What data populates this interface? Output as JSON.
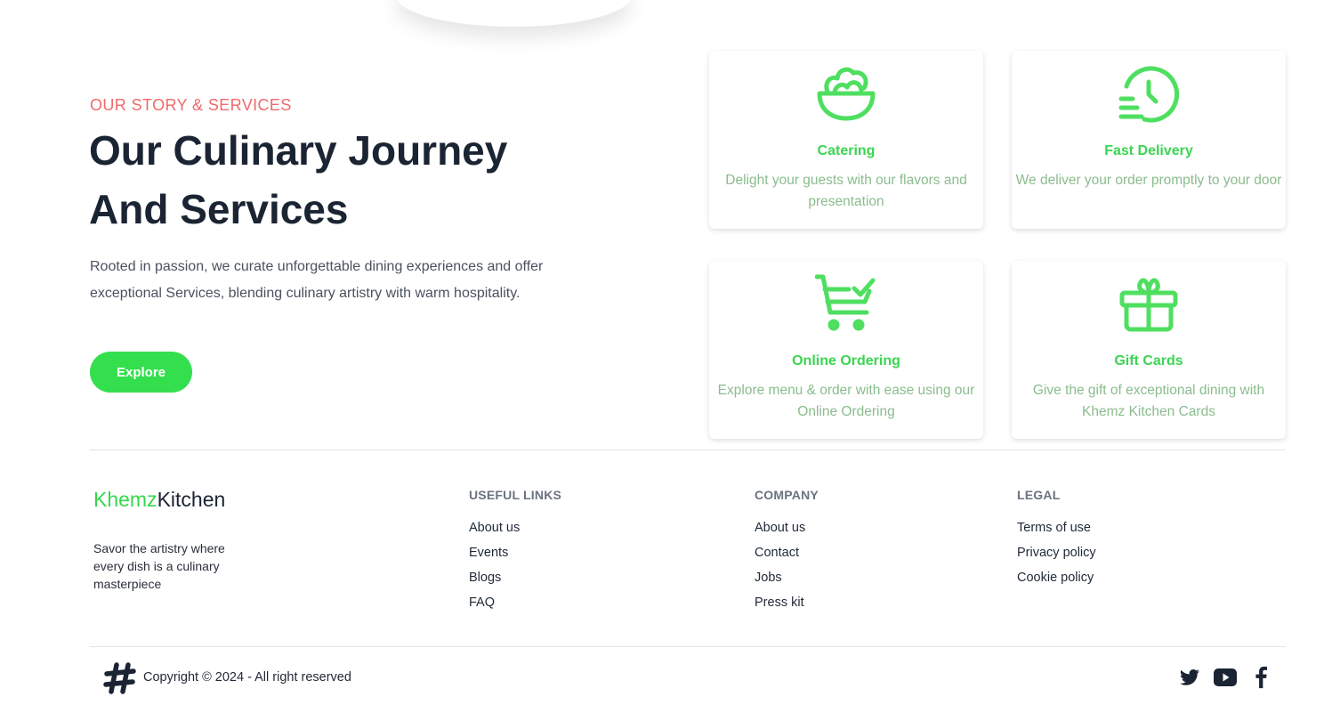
{
  "hero": {
    "eyebrow": "OUR STORY & SERVICES",
    "title_line1": "Our Culinary Journey",
    "title_line2": "And Services",
    "description": "Rooted in passion, we curate unforgettable dining experiences and offer exceptional Services, blending culinary artistry with warm hospitality.",
    "button_label": "Explore"
  },
  "services": [
    {
      "icon": "salad-bowl-icon",
      "title": "Catering",
      "description": "Delight your guests with our flavors and presentation"
    },
    {
      "icon": "clock-delivery-icon",
      "title": "Fast Delivery",
      "description": "We deliver your order promptly to your door"
    },
    {
      "icon": "cart-check-icon",
      "title": "Online Ordering",
      "description": "Explore menu & order with ease using our Online Ordering"
    },
    {
      "icon": "gift-icon",
      "title": "Gift Cards",
      "description": "Give the gift of exceptional dining with Khemz Kitchen Cards"
    }
  ],
  "footer": {
    "brand_part1": "Khemz",
    "brand_part2": "Kitchen",
    "tagline": "Savor the artistry where every dish is a culinary masterpiece",
    "columns": [
      {
        "heading": "USEFUL LINKS",
        "links": [
          "About us",
          "Events",
          "Blogs",
          "FAQ"
        ]
      },
      {
        "heading": "COMPANY",
        "links": [
          "About us",
          "Contact",
          "Jobs",
          "Press kit"
        ]
      },
      {
        "heading": "LEGAL",
        "links": [
          "Terms of use",
          "Privacy policy",
          "Cookie policy"
        ]
      }
    ],
    "copyright": "Copyright © 2024 - All right reserved",
    "social_icons": [
      "twitter-icon",
      "youtube-icon",
      "facebook-icon"
    ]
  },
  "colors": {
    "accent_green": "#34df4e",
    "eyebrow_red": "#f06a6a",
    "heading_dark": "#1b2433",
    "card_text_green": "#8bbc8e"
  }
}
